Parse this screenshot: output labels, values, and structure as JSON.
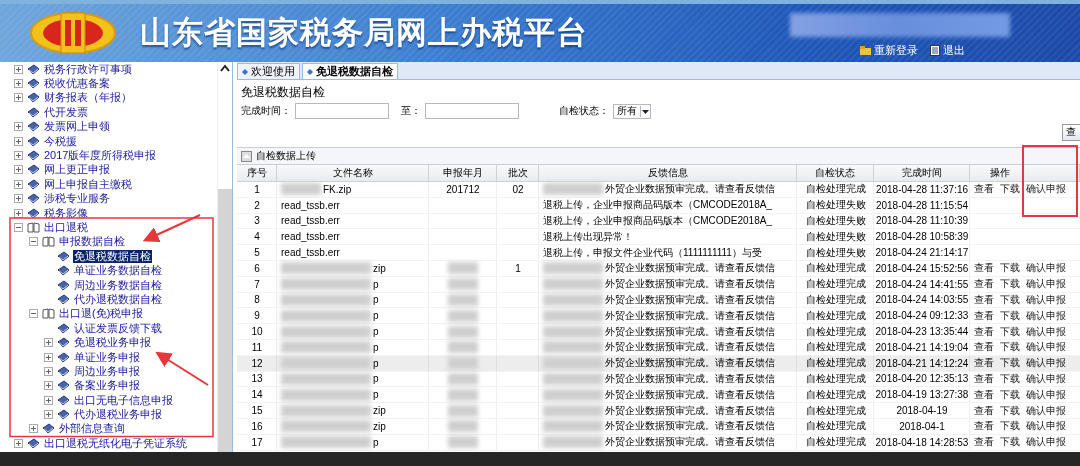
{
  "header": {
    "title": "山东省国家税务局网上办税平台",
    "links": [
      {
        "label": "重新登录",
        "kind": "login"
      },
      {
        "label": "退出",
        "kind": "logout"
      }
    ]
  },
  "sidebar": {
    "items": [
      {
        "label": "税务行政许可事项",
        "expanded": false,
        "selected": false
      },
      {
        "label": "税收优惠备案",
        "expanded": false,
        "selected": false
      },
      {
        "label": "财务报表（年报）",
        "expanded": false,
        "selected": false
      },
      {
        "label": "代开发票",
        "selected": false
      },
      {
        "label": "发票网上申领",
        "expanded": false,
        "selected": false
      },
      {
        "label": "今税援",
        "expanded": false,
        "selected": false
      },
      {
        "label": "2017版年度所得税申报",
        "expanded": false,
        "selected": false
      },
      {
        "label": "网上更正申报",
        "expanded": false,
        "selected": false
      },
      {
        "label": "网上申报自主缴税",
        "expanded": false,
        "selected": false
      },
      {
        "label": "涉税专业服务",
        "expanded": false,
        "selected": false
      },
      {
        "label": "税务影像",
        "expanded": false,
        "selected": false
      },
      {
        "label": "出口退税",
        "expanded": true,
        "selected": false,
        "children": [
          {
            "label": "申报数据自检",
            "expanded": true,
            "selected": false,
            "children": [
              {
                "label": "免退税数据自检",
                "selected": true
              },
              {
                "label": "单证业务数据自检",
                "selected": false
              },
              {
                "label": "周边业务数据自检",
                "selected": false
              },
              {
                "label": "代办退税数据自检",
                "selected": false
              }
            ]
          },
          {
            "label": "出口退(免)税申报",
            "expanded": true,
            "selected": false,
            "children": [
              {
                "label": "认证发票反馈下载",
                "selected": false
              },
              {
                "label": "免退税业务申报",
                "expanded": false,
                "selected": false
              },
              {
                "label": "单证业务申报",
                "expanded": false,
                "selected": false
              },
              {
                "label": "周边业务申报",
                "expanded": false,
                "selected": false
              },
              {
                "label": "备案业务申报",
                "expanded": false,
                "selected": false
              },
              {
                "label": "出口无电子信息申报",
                "expanded": false,
                "selected": false
              },
              {
                "label": "代办退税业务申报",
                "expanded": false,
                "selected": false
              }
            ]
          },
          {
            "label": "外部信息查询",
            "expanded": false,
            "selected": false
          }
        ]
      },
      {
        "label": "出口退税无纸化电子凭证系统",
        "expanded": false,
        "selected": false
      }
    ]
  },
  "tabs": [
    {
      "label": "欢迎使用",
      "selected": false
    },
    {
      "label": "免退税数据自检",
      "selected": true
    }
  ],
  "page_title": "免退税数据自检",
  "filters": {
    "from_label": "完成时间：",
    "to_label": "至：",
    "status_label": "自检状态：",
    "status_value": "所有",
    "query_button": "查"
  },
  "toolbar": {
    "upload_button": "自检数据上传"
  },
  "table": {
    "columns": [
      "序号",
      "文件名称",
      "申报年月",
      "批次",
      "反馈信息",
      "自检状态",
      "完成时间",
      "操作"
    ],
    "rows": [
      {
        "no": "1",
        "file": "FK.zip",
        "month": "201712",
        "batch": "02",
        "feedback": "外贸企业数据预审完成。请查看反馈信",
        "status": "自检处理完成",
        "time": "2018-04-28 11:37:16",
        "actions": [
          "查看",
          "下载",
          "确认申报"
        ],
        "redacted": true,
        "selected": false
      },
      {
        "no": "2",
        "file": "read_tssb.err",
        "feedback": "退税上传，企业申报商品码版本（CMCODE2018A_",
        "status": "自检处理失败",
        "time": "2018-04-28 11:15:54",
        "redacted": false,
        "selected": false
      },
      {
        "no": "3",
        "file": "read_tssb.err",
        "feedback": "退税上传，企业申报商品码版本（CMCODE2018A_",
        "status": "自检处理失败",
        "time": "2018-04-28 11:10:39",
        "redacted": false,
        "selected": false
      },
      {
        "no": "4",
        "file": "read_tssb.err",
        "feedback": "退税上传出现异常！",
        "status": "自检处理失败",
        "time": "2018-04-28 10:58:39",
        "redacted": false,
        "selected": false
      },
      {
        "no": "5",
        "file": "read_tssb.err",
        "feedback": "退税上传，申报文件企业代码（1111111111）与受",
        "status": "自检处理失败",
        "time": "2018-04-24 21:14:17",
        "redacted": false,
        "selected": false
      },
      {
        "no": "6",
        "file": "zip",
        "batch": "1",
        "feedback": "外贸企业数据预审完成。请查看反馈信",
        "status": "自检处理完成",
        "time": "2018-04-24 15:52:56",
        "actions": [
          "查看",
          "下载",
          "确认申报"
        ],
        "redacted": true,
        "selected": false
      },
      {
        "no": "7",
        "file": "p",
        "feedback": "外贸企业数据预审完成。请查看反馈信",
        "status": "自检处理完成",
        "time": "2018-04-24 14:41:55",
        "actions": [
          "查看",
          "下载",
          "确认申报"
        ],
        "redacted": true,
        "selected": false
      },
      {
        "no": "8",
        "file": "p",
        "feedback": "外贸企业数据预审完成。请查看反馈信",
        "status": "自检处理完成",
        "time": "2018-04-24 14:03:55",
        "actions": [
          "查看",
          "下载",
          "确认申报"
        ],
        "redacted": true,
        "selected": false
      },
      {
        "no": "9",
        "file": "p",
        "feedback": "外贸企业数据预审完成。请查看反馈信",
        "status": "自检处理完成",
        "time": "2018-04-24 09:12:33",
        "actions": [
          "查看",
          "下载",
          "确认申报"
        ],
        "redacted": true,
        "selected": false
      },
      {
        "no": "10",
        "file": "p",
        "feedback": "外贸企业数据预审完成。请查看反馈信",
        "status": "自检处理完成",
        "time": "2018-04-23 13:35:44",
        "actions": [
          "查看",
          "下载",
          "确认申报"
        ],
        "redacted": true,
        "selected": false
      },
      {
        "no": "11",
        "file": "p",
        "feedback": "外贸企业数据预审完成。请查看反馈信",
        "status": "自检处理完成",
        "time": "2018-04-21 14:19:04",
        "actions": [
          "查看",
          "下载",
          "确认申报"
        ],
        "redacted": true,
        "selected": false
      },
      {
        "no": "12",
        "file": "p",
        "feedback": "外贸企业数据预审完成。请查看反馈信",
        "status": "自检处理完成",
        "time": "2018-04-21 14:12:24",
        "actions": [
          "查看",
          "下载",
          "确认申报"
        ],
        "redacted": true,
        "selected": true
      },
      {
        "no": "13",
        "file": "p",
        "feedback": "外贸企业数据预审完成。请查看反馈信",
        "status": "自检处理完成",
        "time": "2018-04-20 12:35:13",
        "actions": [
          "查看",
          "下载",
          "确认申报"
        ],
        "redacted": true,
        "selected": false
      },
      {
        "no": "14",
        "file": "p",
        "feedback": "外贸企业数据预审完成。请查看反馈信",
        "status": "自检处理完成",
        "time": "2018-04-19 13:27:38",
        "actions": [
          "查看",
          "下载",
          "确认申报"
        ],
        "redacted": true,
        "selected": false
      },
      {
        "no": "15",
        "file": "zip",
        "feedback": "外贸企业数据预审完成。请查看反馈信",
        "status": "自检处理完成",
        "time": "2018-04-19",
        "actions": [
          "查看",
          "下载",
          "确认申报"
        ],
        "redacted": true,
        "selected": false
      },
      {
        "no": "16",
        "file": "zip",
        "feedback": "外贸企业数据预审完成。请查看反馈信",
        "status": "自检处理完成",
        "time": "2018-04-1",
        "actions": [
          "查看",
          "下载",
          "确认申报"
        ],
        "redacted": true,
        "selected": false
      },
      {
        "no": "17",
        "file": "p",
        "feedback": "外贸企业数据预审完成。请查看反馈信",
        "status": "自检处理完成",
        "time": "2018-04-18 14:28:53",
        "actions": [
          "查看",
          "下载",
          "确认申报"
        ],
        "redacted": true,
        "selected": false
      }
    ]
  }
}
